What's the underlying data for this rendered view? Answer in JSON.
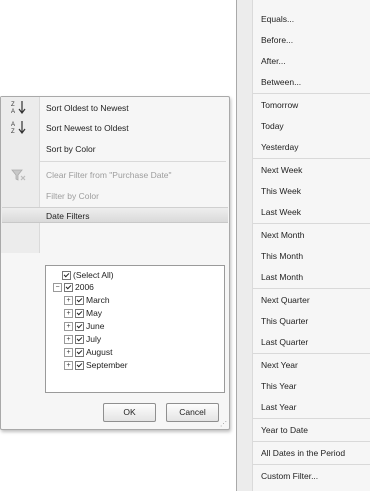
{
  "filter_menu": {
    "sort_oldest": "Sort Oldest to Newest",
    "sort_newest": "Sort Newest to Oldest",
    "sort_by_color": "Sort by Color",
    "clear_filter": "Clear Filter from \"Purchase Date\"",
    "filter_by_color": "Filter by Color",
    "date_filters": "Date Filters",
    "tree": {
      "select_all": "(Select All)",
      "year": "2006",
      "months": [
        "March",
        "May",
        "June",
        "July",
        "August",
        "September"
      ]
    },
    "ok_label": "OK",
    "cancel_label": "Cancel"
  },
  "date_menu": {
    "items": [
      "Equals...",
      "Before...",
      "After...",
      "Between...",
      "Tomorrow",
      "Today",
      "Yesterday",
      "Next Week",
      "This Week",
      "Last Week",
      "Next Month",
      "This Month",
      "Last Month",
      "Next Quarter",
      "This Quarter",
      "Last Quarter",
      "Next Year",
      "This Year",
      "Last Year",
      "Year to Date",
      "All Dates in the Period",
      "Custom Filter..."
    ]
  }
}
